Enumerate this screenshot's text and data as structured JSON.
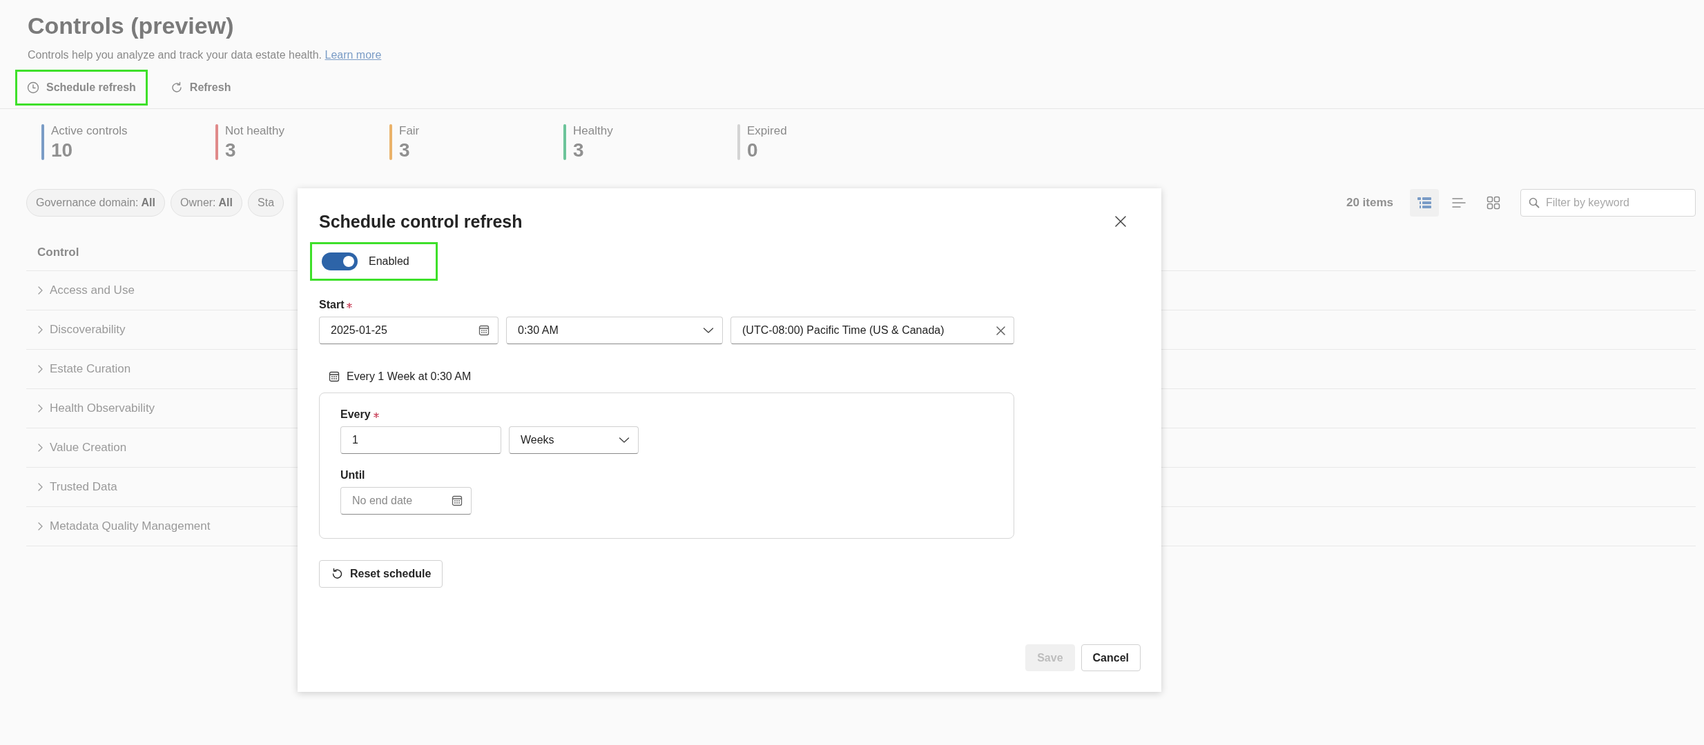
{
  "page": {
    "title": "Controls (preview)",
    "description": "Controls help you analyze and track your data estate health.",
    "learn_more": "Learn more",
    "toolbar": [
      {
        "kind": "schedule",
        "label": "Schedule refresh",
        "highlighted": true
      },
      {
        "kind": "refresh",
        "label": "Refresh",
        "highlighted": false
      }
    ],
    "stats": [
      {
        "label": "Active controls",
        "value": "10",
        "color": "#7a9cc6"
      },
      {
        "label": "Not healthy",
        "value": "3",
        "color": "#e08a8a"
      },
      {
        "label": "Fair",
        "value": "3",
        "color": "#eab26a"
      },
      {
        "label": "Healthy",
        "value": "3",
        "color": "#6cc49a"
      },
      {
        "label": "Expired",
        "value": "0",
        "color": "#d4d4d4"
      }
    ],
    "filters": [
      {
        "label": "Governance domain:",
        "value": "All"
      },
      {
        "label": "Owner:",
        "value": "All"
      },
      {
        "label": "Sta"
      }
    ],
    "item_count": "20 items",
    "views": [
      {
        "kind": "detail",
        "selected": true
      },
      {
        "kind": "lines",
        "selected": false
      },
      {
        "kind": "grid",
        "selected": false
      }
    ],
    "search": {
      "placeholder": "Filter by keyword"
    },
    "table": {
      "columns": [
        "Control"
      ],
      "rows": [
        {
          "name": "Access and Use",
          "expanded": false
        },
        {
          "name": "Discoverability",
          "expanded": false
        },
        {
          "name": "Estate Curation",
          "expanded": false
        },
        {
          "name": "Health Observability",
          "expanded": false
        },
        {
          "name": "Value Creation",
          "expanded": false
        },
        {
          "name": "Trusted Data",
          "expanded": false
        },
        {
          "name": "Metadata Quality Management",
          "expanded": false
        }
      ]
    }
  },
  "dialog": {
    "title": "Schedule control refresh",
    "toggle": {
      "label": "Enabled",
      "on": true,
      "highlighted": true
    },
    "start": {
      "label": "Start",
      "required": true,
      "date": "2025-01-25",
      "time": "0:30 AM",
      "timezone": "(UTC-08:00) Pacific Time (US & Canada)"
    },
    "summary": "Every 1 Week at 0:30 AM",
    "recurrence": {
      "every_label": "Every",
      "every_required": true,
      "every_value": "1",
      "unit": "Weeks",
      "until_label": "Until",
      "until_placeholder": "No end date"
    },
    "reset_button": "Reset schedule",
    "buttons": [
      {
        "label": "Save",
        "disabled": true
      },
      {
        "label": "Cancel",
        "disabled": false
      }
    ]
  }
}
